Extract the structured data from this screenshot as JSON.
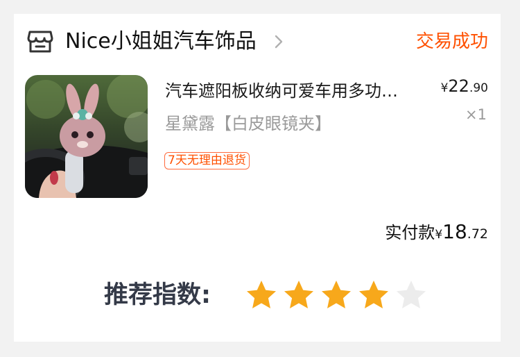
{
  "store": {
    "name": "Nice小姐姐汽车饰品",
    "status": "交易成功",
    "icon": "store-icon"
  },
  "product": {
    "title": "汽车遮阳板收纳可爱车用多功…",
    "sku": "星黛露【白皮眼镜夹】",
    "tag": "7天无理由退货",
    "price": {
      "currency": "¥",
      "integer": "22",
      "decimal": ".90"
    },
    "quantity": "×1"
  },
  "paid": {
    "label": "实付款",
    "currency": "¥",
    "integer": "18",
    "decimal": ".72"
  },
  "rating": {
    "label": "推荐指数:",
    "value": 4,
    "max": 5,
    "colors": {
      "filled": "#f7a81b",
      "empty": "#ececec"
    }
  },
  "colors": {
    "accent": "#ff5000",
    "text": "#111111",
    "muted": "#9a9a9a",
    "background": "#f2f2f2"
  }
}
